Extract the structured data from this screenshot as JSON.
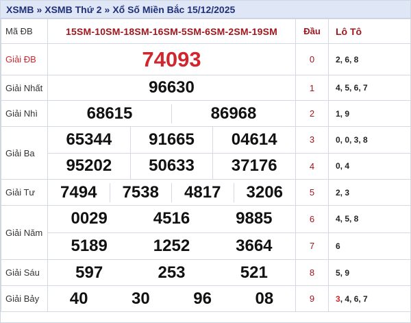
{
  "breadcrumb": {
    "home": "XSMB",
    "sep1": "»",
    "day": "XSMB Thứ 2",
    "sep2": "»",
    "page": "Xổ Số Miền Bắc 15/12/2025"
  },
  "header": {
    "ma_db_label": "Mã ĐB",
    "ma_db_value": "15SM-10SM-18SM-16SM-5SM-6SM-2SM-19SM",
    "dau_label": "Đầu",
    "loto_label": "Lô Tô"
  },
  "prizes": {
    "db": {
      "label": "Giải ĐB",
      "numbers": [
        "74093"
      ]
    },
    "nhat": {
      "label": "Giải Nhất",
      "numbers": [
        "96630"
      ]
    },
    "nhi": {
      "label": "Giải Nhì",
      "numbers": [
        "68615",
        "86968"
      ]
    },
    "ba": {
      "label": "Giải Ba",
      "numbers": [
        "65344",
        "91665",
        "04614",
        "95202",
        "50633",
        "37176"
      ]
    },
    "tu": {
      "label": "Giải Tư",
      "numbers": [
        "7494",
        "7538",
        "4817",
        "3206"
      ]
    },
    "nam": {
      "label": "Giải Năm",
      "numbers": [
        "0029",
        "4516",
        "9885",
        "5189",
        "1252",
        "3664"
      ]
    },
    "sau": {
      "label": "Giải Sáu",
      "numbers": [
        "597",
        "253",
        "521"
      ]
    },
    "bay": {
      "label": "Giải Bảy",
      "numbers": [
        "40",
        "30",
        "96",
        "08"
      ]
    }
  },
  "loto": [
    {
      "dau": "0",
      "values": "2, 6, 8"
    },
    {
      "dau": "1",
      "values": "4, 5, 6, 7"
    },
    {
      "dau": "2",
      "values": "1, 9"
    },
    {
      "dau": "3",
      "values": "0, 0, 3, 8"
    },
    {
      "dau": "4",
      "values": "0, 4"
    },
    {
      "dau": "5",
      "values": "2, 3"
    },
    {
      "dau": "6",
      "values": "4, 5, 8"
    },
    {
      "dau": "7",
      "values": "6"
    },
    {
      "dau": "8",
      "values": "5, 9"
    },
    {
      "dau": "9",
      "values_highlight": "3",
      "values_rest": ", 4, 6, 7"
    }
  ],
  "colors": {
    "accent_red": "#d0262d",
    "dark_red": "#a0161d",
    "title_blue": "#1f2f7a",
    "title_bg": "#dfe6f5"
  }
}
